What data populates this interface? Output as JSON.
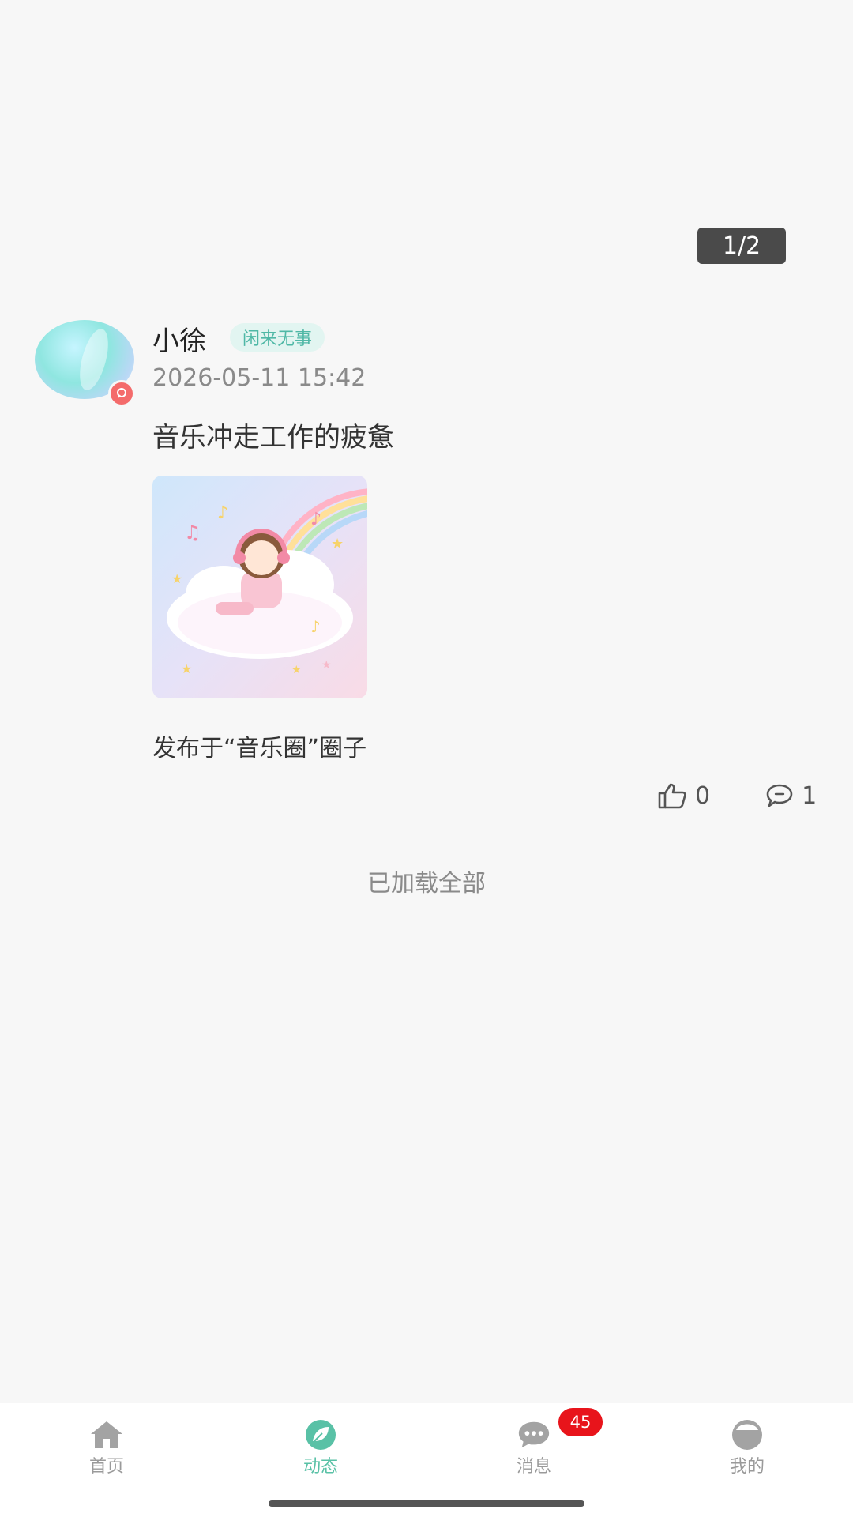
{
  "pager": {
    "text": "1/2"
  },
  "post": {
    "username": "小徐",
    "tag": "闲来无事",
    "timestamp": "2026-05-11 15:42",
    "text": "音乐冲走工作的疲惫",
    "image_icon": "girl-on-cloud-with-headphones-illustration",
    "published_in": "发布于“音乐圈”圈子",
    "likes": "0",
    "comments": "1"
  },
  "feed": {
    "loaded_all": "已加载全部"
  },
  "tabbar": {
    "tabs": [
      {
        "label": "首页",
        "icon": "home-icon",
        "active": false
      },
      {
        "label": "动态",
        "icon": "leaf-icon",
        "active": true
      },
      {
        "label": "消息",
        "icon": "chat-bubble-icon",
        "active": false,
        "badge": "45"
      },
      {
        "label": "我的",
        "icon": "profile-icon",
        "active": false
      }
    ]
  },
  "colors": {
    "accent": "#59c1a6",
    "badge": "#e8141b",
    "tag_bg": "#e2f5f1",
    "tag_text": "#4fb8a6"
  }
}
